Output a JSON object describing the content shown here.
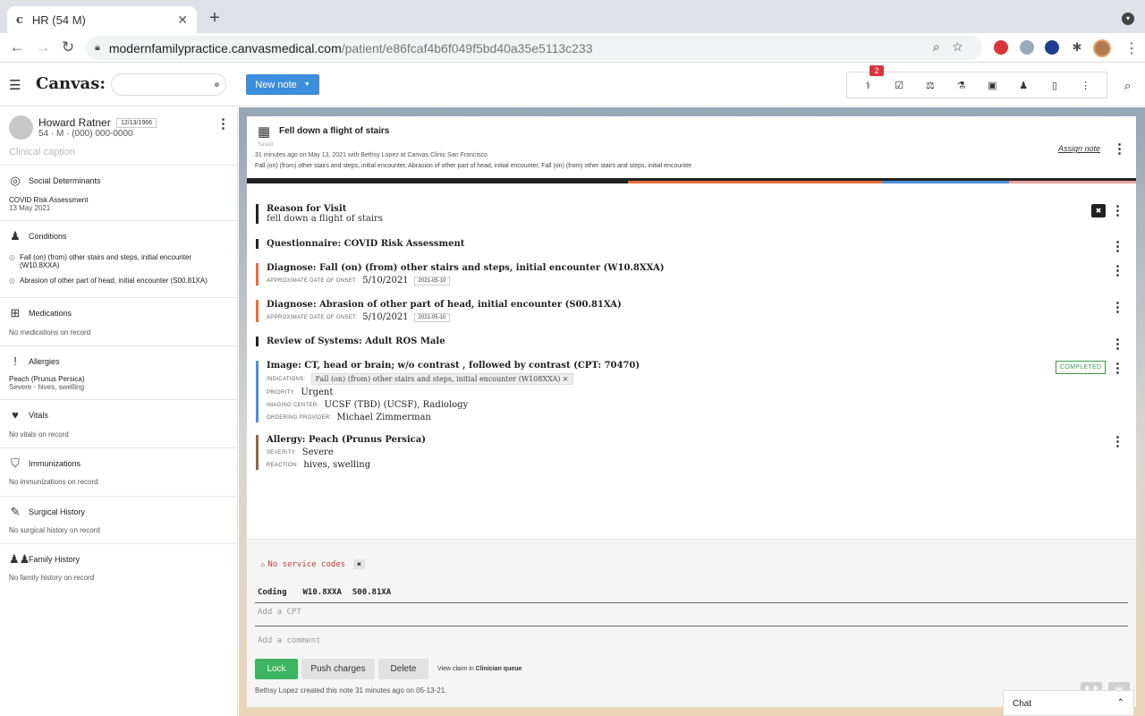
{
  "browser": {
    "tab_title": "HR (54 M)",
    "tab_favicon": "c",
    "url_host": "modernfamilypractice.canvasmedical.com",
    "url_path": "/patient/e86fcaf4b6f049f5bd40a35e5113c233"
  },
  "app": {
    "logo": "Canvas:",
    "new_note_label": "New note",
    "notification_count": "2"
  },
  "patient": {
    "name": "Howard Ratner",
    "dob": "12/13/1966",
    "demographics": "54 · M · (000) 000-0000",
    "caption_placeholder": "Clinical caption"
  },
  "sidebar": {
    "social_determinants": {
      "title": "Social Determinants",
      "line1": "COVID Risk Assessment",
      "line2": "13 May 2021"
    },
    "conditions": {
      "title": "Conditions",
      "items": [
        "Fall (on) (from) other stairs and steps, initial encounter (W10.8XXA)",
        "Abrasion of other part of head, initial encounter (S00.81XA)"
      ]
    },
    "medications": {
      "title": "Medications",
      "line1": "No medications on record"
    },
    "allergies": {
      "title": "Allergies",
      "line1": "Peach (Prunus Persica)",
      "line2": "Severe - hives, swelling"
    },
    "vitals": {
      "title": "Vitals",
      "line1": "No vitals on record"
    },
    "immunizations": {
      "title": "Immunizations",
      "line1": "No immunizations on record"
    },
    "surgical_history": {
      "title": "Surgical History",
      "line1": "No surgical history on record"
    },
    "family_history": {
      "title": "Family History",
      "line1": "No family history on record"
    }
  },
  "note": {
    "title": "Fell down a flight of stairs",
    "saved": "Saved",
    "meta": "31 minutes ago on May 13, 2021 with Bethsy Lopez at Canvas Clinic San Francisco",
    "diagnoses_summary": "Fall (on) (from) other stairs and steps, initial encounter, Abrasion of other part of head, initial encounter, Fall (on) (from) other stairs and steps, initial encounter",
    "assign_label": "Assign note",
    "reason": {
      "heading": "Reason for Visit",
      "text": "fell down a flight of stairs"
    },
    "questionnaire": "Questionnaire: COVID Risk Assessment",
    "diagnose1": {
      "heading": "Diagnose: Fall (on) (from) other stairs and steps, initial encounter  (W10.8XXA)",
      "onset_label": "APPROXIMATE DATE OF ONSET:",
      "onset": "5/10/2021",
      "chip": "2021-05-10"
    },
    "diagnose2": {
      "heading": "Diagnose: Abrasion of other part of head, initial encounter  (S00.81XA)",
      "onset_label": "APPROXIMATE DATE OF ONSET:",
      "onset": "5/10/2021",
      "chip": "2021-05-10"
    },
    "ros": "Review of Systems: Adult ROS Male",
    "image": {
      "heading": "Image: CT, head or brain; w/o contrast , followed by contrast (CPT: 70470)",
      "status": "COMPLETED",
      "indications_label": "INDICATIONS:",
      "indication": "Fall (on) (from) other stairs and steps, initial encounter (W108XXA)  ×",
      "priority_label": "PRIORITY:",
      "priority": "Urgent",
      "center_label": "IMAGING CENTER:",
      "center": "UCSF (TBD) (UCSF), Radiology",
      "provider_label": "ORDERING PROVIDER:",
      "provider": "Michael Zimmerman"
    },
    "allergy": {
      "heading": "Allergy: Peach (Prunus Persica)",
      "severity_label": "SEVERITY:",
      "severity": "Severe",
      "reaction_label": "REACTION:",
      "reaction": "hives, swelling"
    }
  },
  "billing": {
    "no_service_codes": "No service codes",
    "coding_label": "Coding",
    "codes": [
      "W10.8XXA",
      "S00.81XA"
    ],
    "cpt_placeholder": "Add a CPT",
    "comment_placeholder": "Add a comment",
    "lock_label": "Lock",
    "push_label": "Push charges",
    "delete_label": "Delete",
    "view_claim_prefix": "View claim in ",
    "view_claim_queue": "Clinician queue",
    "created_text": "Bethsy Lopez created this note 31 minutes ago on 05-13-21."
  },
  "chat": {
    "label": "Chat"
  },
  "colors": {
    "accent": "#3d8edb",
    "lock": "#3db460",
    "alert": "#c43c3c",
    "completed": "#3a9a4a"
  }
}
